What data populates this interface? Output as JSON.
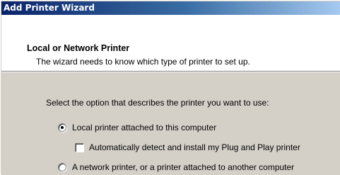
{
  "window": {
    "title": "Add Printer Wizard"
  },
  "header": {
    "title": "Local or Network Printer",
    "subtitle": "The wizard needs to know which type of printer to set up."
  },
  "body": {
    "prompt": "Select the option that describes the printer you want to use:",
    "options": [
      {
        "label": "Local printer attached to this computer",
        "selected": true
      },
      {
        "label": "A network printer, or a printer attached to another computer",
        "selected": false
      }
    ],
    "checkbox": {
      "label": "Automatically detect and install my Plug and Play printer",
      "checked": false
    }
  },
  "colors": {
    "titlebar_start": "#0a246a",
    "titlebar_end": "#a6caf0",
    "dialog_bg": "#d4d0c8",
    "header_bg": "#ffffff"
  },
  "icons": {
    "radio_selected": "radio-selected-icon",
    "radio_unselected": "radio-unselected-icon",
    "checkbox_unchecked": "checkbox-unchecked-icon"
  }
}
